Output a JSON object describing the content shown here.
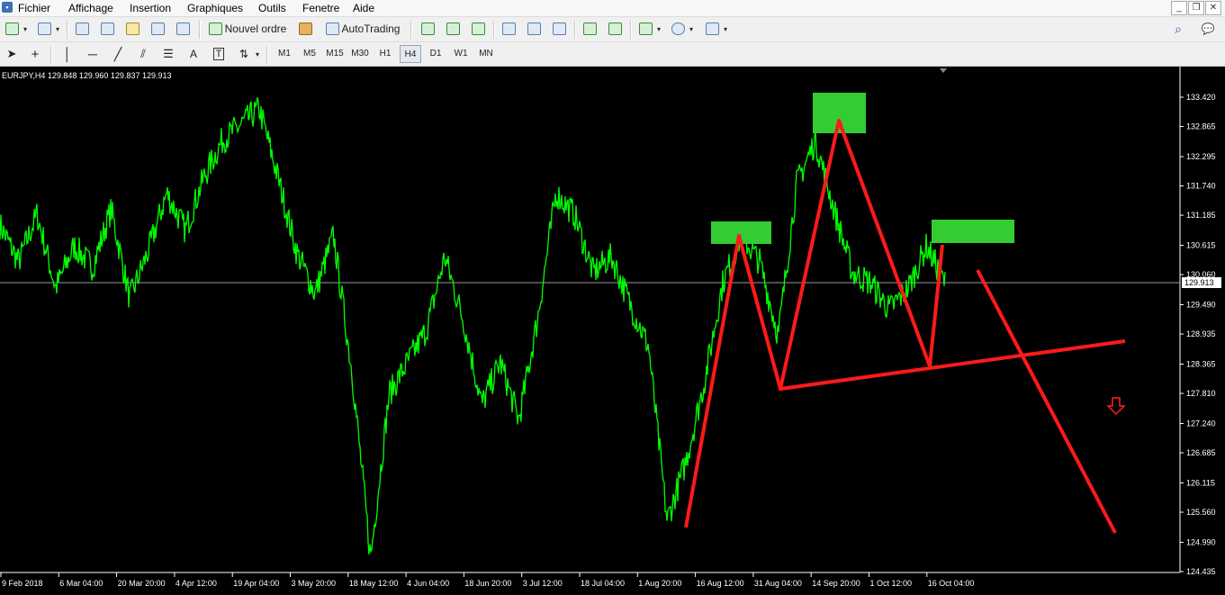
{
  "menu": {
    "items": [
      "Fichier",
      "Affichage",
      "Insertion",
      "Graphiques",
      "Outils",
      "Fenetre",
      "Aide"
    ]
  },
  "toolbar": {
    "new_order_label": "Nouvel ordre",
    "autotrading_label": "AutoTrading",
    "timeframes": [
      "M1",
      "M5",
      "M15",
      "M30",
      "H1",
      "H4",
      "D1",
      "W1",
      "MN"
    ],
    "active_timeframe": "H4"
  },
  "chart": {
    "header_text": "EURJPY,H4  129.848 129.960 129.837 129.913",
    "current_price": "129.913",
    "colors": {
      "background": "#000000",
      "price_line": "#00ff00",
      "pattern": "#ff0000",
      "zone": "#33cc33",
      "axis_text": "#ffffff"
    },
    "y_ticks": [
      "133.420",
      "132.865",
      "132.295",
      "131.740",
      "131.185",
      "130.615",
      "130.060",
      "129.490",
      "128.935",
      "128.365",
      "127.810",
      "127.240",
      "126.685",
      "126.115",
      "125.560",
      "124.990",
      "124.435"
    ],
    "x_ticks": [
      "9 Feb 2018",
      "6 Mar 04:00",
      "20 Mar 20:00",
      "4 Apr 12:00",
      "19 Apr 04:00",
      "3 May 20:00",
      "18 May 12:00",
      "4 Jun 04:00",
      "18 Jun 20:00",
      "3 Jul 12:00",
      "18 Jul 04:00",
      "1 Aug 20:00",
      "16 Aug 12:00",
      "31 Aug 04:00",
      "14 Sep 20:00",
      "1 Oct 12:00",
      "16 Oct 04:00"
    ],
    "down_arrow_icon": "down-arrow-icon"
  },
  "chart_data": {
    "type": "line",
    "symbol": "EURJPY",
    "timeframe": "H4",
    "ohlc_last": {
      "open": 129.848,
      "high": 129.96,
      "low": 129.837,
      "close": 129.913
    },
    "ylim": [
      124.435,
      133.42
    ],
    "x": [
      "9 Feb 2018",
      "6 Mar 04:00",
      "20 Mar 20:00",
      "4 Apr 12:00",
      "19 Apr 04:00",
      "3 May 20:00",
      "18 May 12:00",
      "4 Jun 04:00",
      "18 Jun 20:00",
      "3 Jul 12:00",
      "18 Jul 04:00",
      "1 Aug 20:00",
      "16 Aug 12:00",
      "31 Aug 04:00",
      "14 Sep 20:00",
      "1 Oct 12:00",
      "16 Oct 04:00"
    ],
    "series": [
      {
        "values": [
          131.0,
          130.3,
          131.2,
          129.8,
          130.6,
          130.2,
          131.3,
          129.6,
          130.5,
          131.6,
          130.9,
          131.9,
          132.6,
          132.9,
          133.2,
          131.9,
          130.5,
          129.7,
          130.8,
          128.2,
          124.7,
          127.8,
          128.4,
          129.0,
          130.4,
          129.2,
          127.6,
          128.4,
          127.3,
          129.2,
          131.6,
          131.2,
          130.1,
          130.4,
          129.5,
          128.7,
          125.4,
          126.5,
          128.0,
          129.9,
          130.8,
          130.3,
          128.9,
          131.8,
          132.6,
          131.3,
          130.1,
          129.9,
          129.4,
          129.8,
          130.6,
          129.9
        ]
      }
    ]
  }
}
